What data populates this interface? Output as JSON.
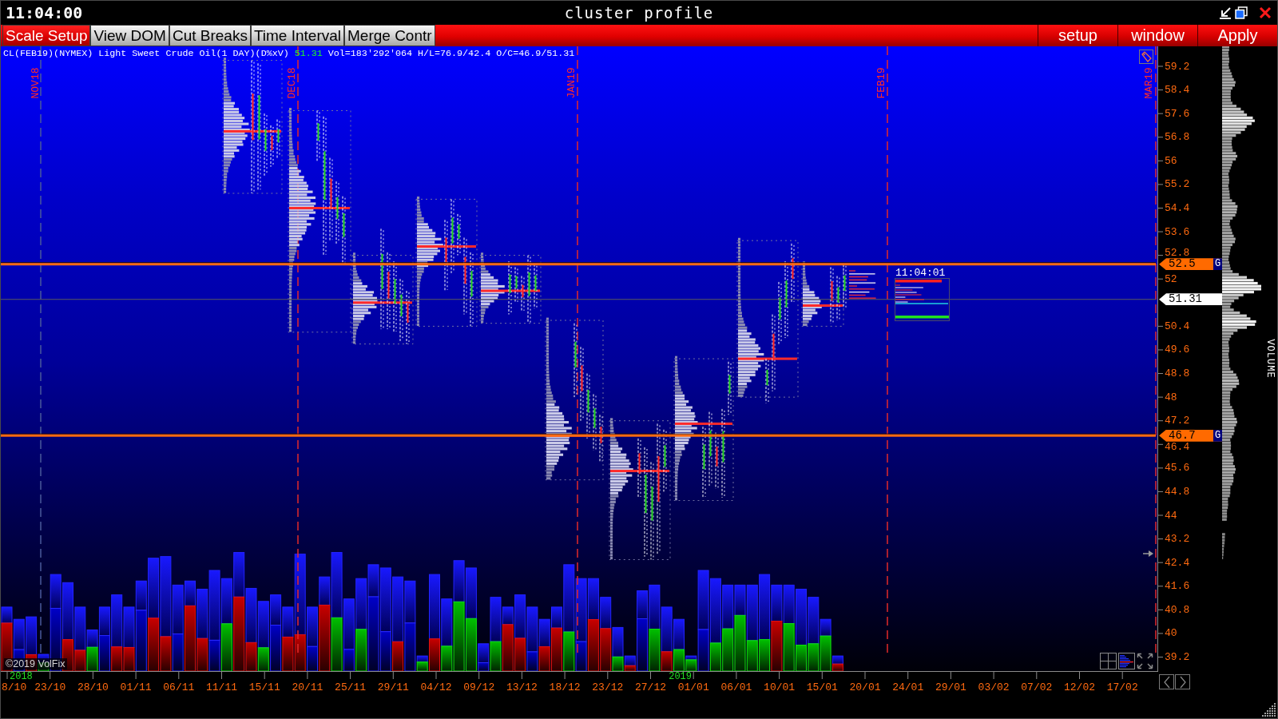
{
  "title_bar": {
    "clock": "11:04:00",
    "title": "cluster profile"
  },
  "toolbar": {
    "left_buttons": [
      {
        "label": "Scale Setup",
        "selected": true
      },
      {
        "label": "View DOM",
        "selected": false
      },
      {
        "label": "Cut Breaks",
        "selected": false
      },
      {
        "label": "Time Interval",
        "selected": false
      },
      {
        "label": "Merge Contr",
        "selected": false
      }
    ],
    "right_buttons": [
      "setup",
      "window",
      "Apply"
    ]
  },
  "chart": {
    "info_line": {
      "instrument": "CL(FEB19)(NYMEX) Light Sweet Crude Oil(1 DAY)(D%xV)",
      "last_price": "51.31",
      "volume": "Vol=183'292'064",
      "high_low": "H/L=76.9/42.4",
      "open_close": "O/C=46.9/51.31"
    },
    "contract_markers": [
      "NOV18",
      "DEC18",
      "JAN19",
      "FEB19",
      "MAR19"
    ],
    "countdown": "11:04:01",
    "copyright": "©2019 VolFix",
    "price_axis": {
      "ticks": [
        "59.2",
        "58.4",
        "57.6",
        "56.8",
        "56",
        "55.2",
        "54.4",
        "53.6",
        "52.8",
        "52",
        "50.4",
        "49.6",
        "48.8",
        "48",
        "47.2",
        "46.4",
        "45.6",
        "44.8",
        "44",
        "43.2",
        "42.4",
        "41.6",
        "40.8",
        "40",
        "39.2"
      ]
    },
    "price_markers": [
      {
        "kind": "level",
        "price": "52.5",
        "flag": "G"
      },
      {
        "kind": "last",
        "price": "51.31"
      },
      {
        "kind": "level",
        "price": "46.7",
        "flag": "G"
      }
    ],
    "date_axis": {
      "ticks": [
        {
          "label": "8/10",
          "year": "2018"
        },
        {
          "label": "23/10"
        },
        {
          "label": "28/10"
        },
        {
          "label": "01/11"
        },
        {
          "label": "06/11"
        },
        {
          "label": "11/11"
        },
        {
          "label": "15/11"
        },
        {
          "label": "20/11"
        },
        {
          "label": "25/11"
        },
        {
          "label": "29/11"
        },
        {
          "label": "04/12"
        },
        {
          "label": "09/12"
        },
        {
          "label": "13/12"
        },
        {
          "label": "18/12"
        },
        {
          "label": "23/12"
        },
        {
          "label": "27/12"
        },
        {
          "label": "01/01",
          "year": "2019"
        },
        {
          "label": "06/01"
        },
        {
          "label": "10/01"
        },
        {
          "label": "15/01"
        },
        {
          "label": "20/01"
        },
        {
          "label": "24/01"
        },
        {
          "label": "29/01"
        },
        {
          "label": "03/02"
        },
        {
          "label": "07/02"
        },
        {
          "label": "12/02"
        },
        {
          "label": "17/02"
        }
      ]
    },
    "volume_profile": {
      "label": "VOLUME"
    }
  }
}
